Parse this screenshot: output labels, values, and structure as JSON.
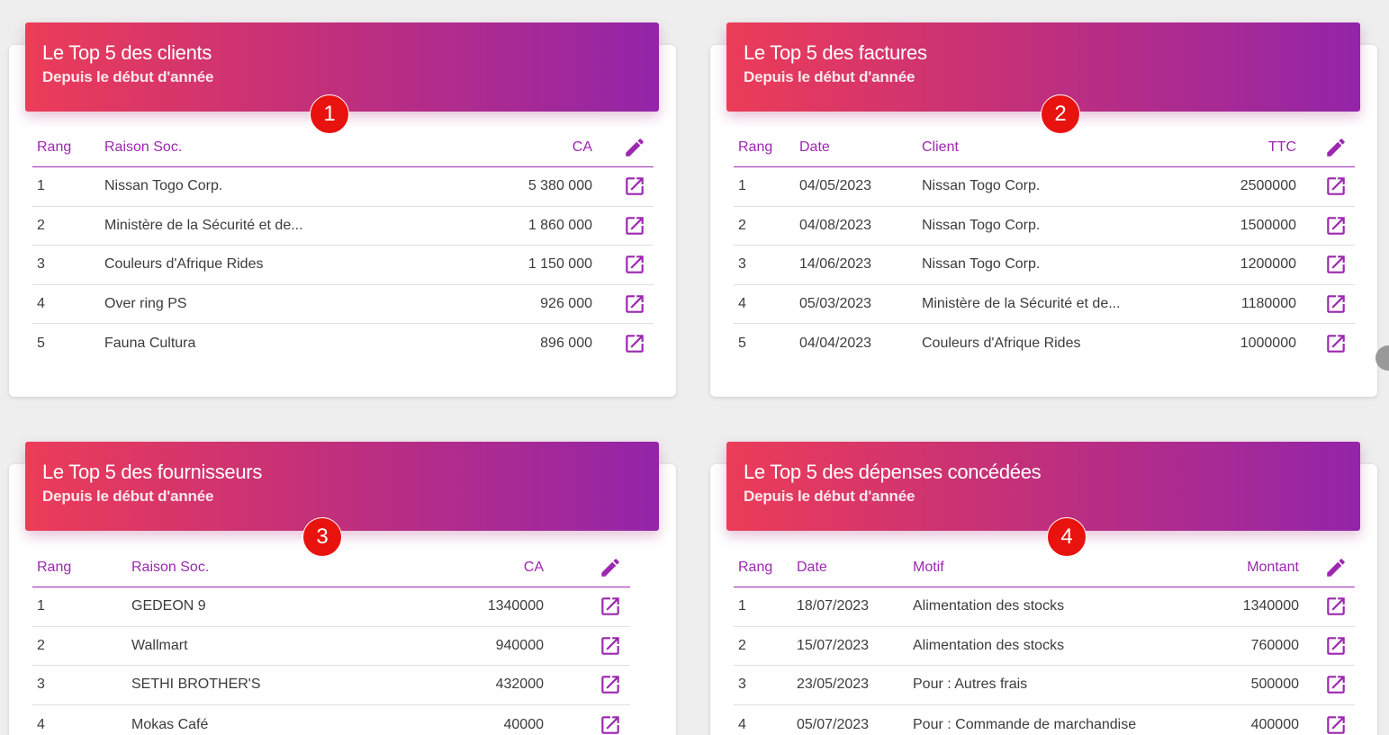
{
  "colors": {
    "accent": "#9c27b0",
    "gradient_start": "#ec3c58",
    "gradient_end": "#9325a9",
    "badge": "#e8130f"
  },
  "cards": {
    "clients": {
      "title": "Le Top 5 des clients",
      "subtitle": "Depuis le début d'année",
      "badge": "1",
      "headers": {
        "rank": "Rang",
        "name": "Raison Soc.",
        "amount": "CA"
      },
      "rows": [
        {
          "rank": "1",
          "name": "Nissan Togo Corp.",
          "amount": "5 380 000"
        },
        {
          "rank": "2",
          "name": "Ministère de la Sécurité et de...",
          "amount": "1 860 000"
        },
        {
          "rank": "3",
          "name": "Couleurs d'Afrique Rides",
          "amount": "1 150 000"
        },
        {
          "rank": "4",
          "name": "Over ring PS",
          "amount": "926 000"
        },
        {
          "rank": "5",
          "name": "Fauna Cultura",
          "amount": "896 000"
        }
      ]
    },
    "invoices": {
      "title": "Le Top 5 des factures",
      "subtitle": "Depuis le début d'année",
      "badge": "2",
      "headers": {
        "rank": "Rang",
        "date": "Date",
        "client": "Client",
        "amount": "TTC"
      },
      "rows": [
        {
          "rank": "1",
          "date": "04/05/2023",
          "client": "Nissan Togo Corp.",
          "amount": "2500000"
        },
        {
          "rank": "2",
          "date": "04/08/2023",
          "client": "Nissan Togo Corp.",
          "amount": "1500000"
        },
        {
          "rank": "3",
          "date": "14/06/2023",
          "client": "Nissan Togo Corp.",
          "amount": "1200000"
        },
        {
          "rank": "4",
          "date": "05/03/2023",
          "client": "Ministère de la Sécurité et de...",
          "amount": "1180000"
        },
        {
          "rank": "5",
          "date": "04/04/2023",
          "client": "Couleurs d'Afrique Rides",
          "amount": "1000000"
        }
      ]
    },
    "suppliers": {
      "title": "Le Top 5 des fournisseurs",
      "subtitle": "Depuis le début d'année",
      "badge": "3",
      "headers": {
        "rank": "Rang",
        "name": "Raison Soc.",
        "amount": "CA"
      },
      "rows": [
        {
          "rank": "1",
          "name": "GEDEON 9",
          "amount": "1340000"
        },
        {
          "rank": "2",
          "name": "Wallmart",
          "amount": "940000"
        },
        {
          "rank": "3",
          "name": "SETHI BROTHER'S",
          "amount": "432000"
        },
        {
          "rank": "4",
          "name": "Mokas Café",
          "amount": "40000"
        }
      ]
    },
    "expenses": {
      "title": "Le Top 5 des dépenses concédées",
      "subtitle": "Depuis le début d'année",
      "badge": "4",
      "headers": {
        "rank": "Rang",
        "date": "Date",
        "reason": "Motif",
        "amount": "Montant"
      },
      "rows": [
        {
          "rank": "1",
          "date": "18/07/2023",
          "reason": "Alimentation des stocks",
          "amount": "1340000"
        },
        {
          "rank": "2",
          "date": "15/07/2023",
          "reason": "Alimentation des stocks",
          "amount": "760000"
        },
        {
          "rank": "3",
          "date": "23/05/2023",
          "reason": "Pour : Autres frais",
          "amount": "500000"
        },
        {
          "rank": "4",
          "date": "05/07/2023",
          "reason": "Pour : Commande de marchandise",
          "amount": "400000"
        }
      ]
    }
  }
}
